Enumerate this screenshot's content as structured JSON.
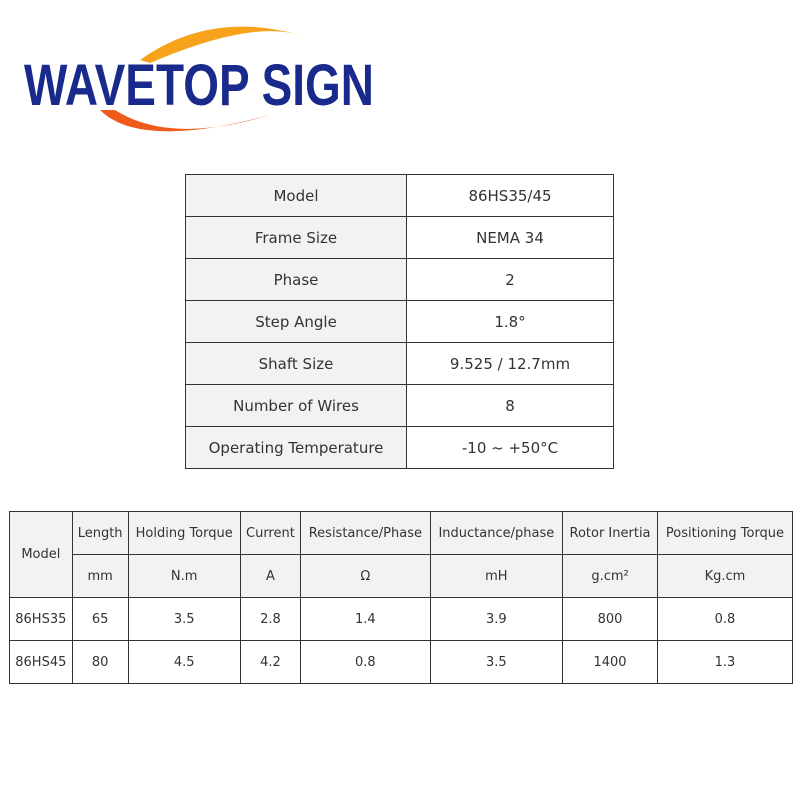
{
  "logo": {
    "text": "WAVETOP SIGN",
    "colors": {
      "text": "#1a2a8c",
      "arc_top": "#f7a21b",
      "arc_bottom": "#f05a1a"
    }
  },
  "spec_table": [
    {
      "label": "Model",
      "value": "86HS35/45"
    },
    {
      "label": "Frame Size",
      "value": "NEMA 34"
    },
    {
      "label": "Phase",
      "value": "2"
    },
    {
      "label": "Step Angle",
      "value": "1.8°"
    },
    {
      "label": "Shaft Size",
      "value": "9.525 / 12.7mm"
    },
    {
      "label": "Number of Wires",
      "value": "8"
    },
    {
      "label": "Operating Temperature",
      "value": "-10 ~ +50°C"
    }
  ],
  "perf_table": {
    "model_header": "Model",
    "headers": [
      "Length",
      "Holding Torque",
      "Current",
      "Resistance/Phase",
      "Inductance/phase",
      "Rotor Inertia",
      "Positioning Torque"
    ],
    "units": [
      "mm",
      "N.m",
      "A",
      "Ω",
      "mH",
      "g.cm²",
      "Kg.cm"
    ],
    "rows": [
      [
        "86HS35",
        "65",
        "3.5",
        "2.8",
        "1.4",
        "3.9",
        "800",
        "0.8"
      ],
      [
        "86HS45",
        "80",
        "4.5",
        "4.2",
        "0.8",
        "3.5",
        "1400",
        "1.3"
      ]
    ]
  }
}
